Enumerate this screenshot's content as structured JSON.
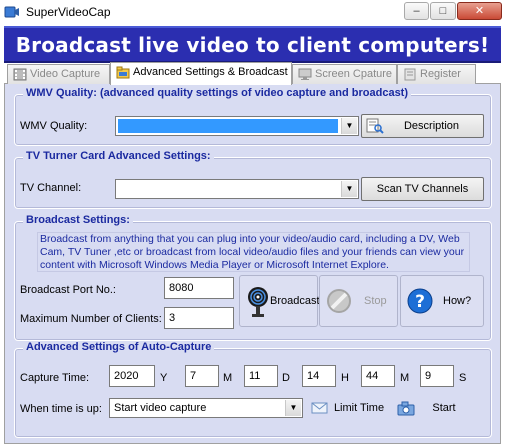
{
  "window": {
    "title": "SuperVideoCap"
  },
  "banner": {
    "text": "Broadcast live video to client computers!"
  },
  "tabs": [
    {
      "label": "Video Capture",
      "icon": "film-icon",
      "active": false
    },
    {
      "label": "Advanced Settings & Broadcast",
      "icon": "folder-icon",
      "active": true
    },
    {
      "label": "Screen Cpature",
      "icon": "monitor-icon",
      "active": false
    },
    {
      "label": "Register",
      "icon": "register-icon",
      "active": false
    }
  ],
  "wmv": {
    "legend": "WMV Quality: (advanced quality settings of video capture and broadcast)",
    "label": "WMV Quality:",
    "value": "",
    "description_button": "Description"
  },
  "tv": {
    "legend": "TV Turner Card Advanced Settings:",
    "label": "TV Channel:",
    "value": "",
    "scan_button": "Scan TV Channels"
  },
  "broadcast": {
    "legend": "Broadcast Settings:",
    "info": "Broadcast from anything that you can plug into your video/audio card, including a DV, Web Cam, TV Tuner ,etc or broadcast from local video/audio files and your friends can view your content with Microsoft Windows Media Player or Microsoft Internet Explore.",
    "port_label": "Broadcast Port No.:",
    "port_value": "8080",
    "max_clients_label": "Maximum Number of Clients:",
    "max_clients_value": "3",
    "broadcast_button": "Broadcast",
    "stop_button": "Stop",
    "how_button": "How?"
  },
  "autocapture": {
    "legend": "Advanced Settings of Auto-Capture",
    "capture_time_label": "Capture Time:",
    "year": "2020",
    "year_unit": "Y",
    "month": "7",
    "month_unit": "M",
    "day": "11",
    "day_unit": "D",
    "hour": "14",
    "hour_unit": "H",
    "minute": "44",
    "minute_unit": "M",
    "second": "9",
    "second_unit": "S",
    "when_label": "When time is up:",
    "when_value": "Start video capture",
    "limit_button": "Limit Time",
    "start_button": "Start"
  },
  "colors": {
    "banner": "#2b2eb0",
    "panel": "#d8dcf2",
    "legend": "#1b2aa0",
    "selection": "#3399ff"
  }
}
